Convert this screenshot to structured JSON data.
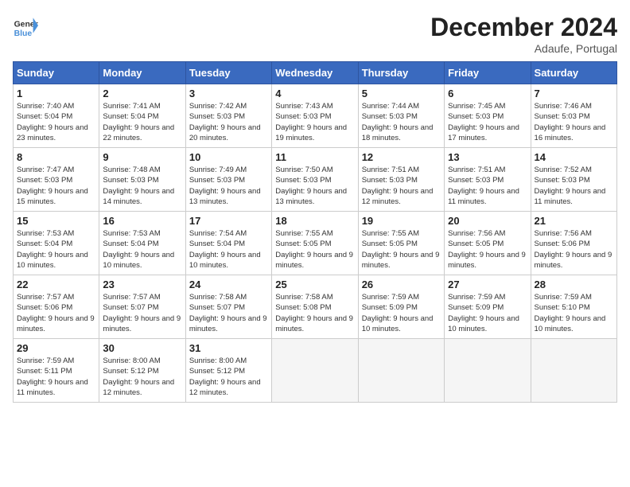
{
  "header": {
    "logo_line1": "General",
    "logo_line2": "Blue",
    "month": "December 2024",
    "location": "Adaufe, Portugal"
  },
  "weekdays": [
    "Sunday",
    "Monday",
    "Tuesday",
    "Wednesday",
    "Thursday",
    "Friday",
    "Saturday"
  ],
  "weeks": [
    [
      {
        "day": 1,
        "sunrise": "7:40 AM",
        "sunset": "5:04 PM",
        "daylight": "9 hours and 23 minutes."
      },
      {
        "day": 2,
        "sunrise": "7:41 AM",
        "sunset": "5:04 PM",
        "daylight": "9 hours and 22 minutes."
      },
      {
        "day": 3,
        "sunrise": "7:42 AM",
        "sunset": "5:03 PM",
        "daylight": "9 hours and 20 minutes."
      },
      {
        "day": 4,
        "sunrise": "7:43 AM",
        "sunset": "5:03 PM",
        "daylight": "9 hours and 19 minutes."
      },
      {
        "day": 5,
        "sunrise": "7:44 AM",
        "sunset": "5:03 PM",
        "daylight": "9 hours and 18 minutes."
      },
      {
        "day": 6,
        "sunrise": "7:45 AM",
        "sunset": "5:03 PM",
        "daylight": "9 hours and 17 minutes."
      },
      {
        "day": 7,
        "sunrise": "7:46 AM",
        "sunset": "5:03 PM",
        "daylight": "9 hours and 16 minutes."
      }
    ],
    [
      {
        "day": 8,
        "sunrise": "7:47 AM",
        "sunset": "5:03 PM",
        "daylight": "9 hours and 15 minutes."
      },
      {
        "day": 9,
        "sunrise": "7:48 AM",
        "sunset": "5:03 PM",
        "daylight": "9 hours and 14 minutes."
      },
      {
        "day": 10,
        "sunrise": "7:49 AM",
        "sunset": "5:03 PM",
        "daylight": "9 hours and 13 minutes."
      },
      {
        "day": 11,
        "sunrise": "7:50 AM",
        "sunset": "5:03 PM",
        "daylight": "9 hours and 13 minutes."
      },
      {
        "day": 12,
        "sunrise": "7:51 AM",
        "sunset": "5:03 PM",
        "daylight": "9 hours and 12 minutes."
      },
      {
        "day": 13,
        "sunrise": "7:51 AM",
        "sunset": "5:03 PM",
        "daylight": "9 hours and 11 minutes."
      },
      {
        "day": 14,
        "sunrise": "7:52 AM",
        "sunset": "5:03 PM",
        "daylight": "9 hours and 11 minutes."
      }
    ],
    [
      {
        "day": 15,
        "sunrise": "7:53 AM",
        "sunset": "5:04 PM",
        "daylight": "9 hours and 10 minutes."
      },
      {
        "day": 16,
        "sunrise": "7:53 AM",
        "sunset": "5:04 PM",
        "daylight": "9 hours and 10 minutes."
      },
      {
        "day": 17,
        "sunrise": "7:54 AM",
        "sunset": "5:04 PM",
        "daylight": "9 hours and 10 minutes."
      },
      {
        "day": 18,
        "sunrise": "7:55 AM",
        "sunset": "5:05 PM",
        "daylight": "9 hours and 9 minutes."
      },
      {
        "day": 19,
        "sunrise": "7:55 AM",
        "sunset": "5:05 PM",
        "daylight": "9 hours and 9 minutes."
      },
      {
        "day": 20,
        "sunrise": "7:56 AM",
        "sunset": "5:05 PM",
        "daylight": "9 hours and 9 minutes."
      },
      {
        "day": 21,
        "sunrise": "7:56 AM",
        "sunset": "5:06 PM",
        "daylight": "9 hours and 9 minutes."
      }
    ],
    [
      {
        "day": 22,
        "sunrise": "7:57 AM",
        "sunset": "5:06 PM",
        "daylight": "9 hours and 9 minutes."
      },
      {
        "day": 23,
        "sunrise": "7:57 AM",
        "sunset": "5:07 PM",
        "daylight": "9 hours and 9 minutes."
      },
      {
        "day": 24,
        "sunrise": "7:58 AM",
        "sunset": "5:07 PM",
        "daylight": "9 hours and 9 minutes."
      },
      {
        "day": 25,
        "sunrise": "7:58 AM",
        "sunset": "5:08 PM",
        "daylight": "9 hours and 9 minutes."
      },
      {
        "day": 26,
        "sunrise": "7:59 AM",
        "sunset": "5:09 PM",
        "daylight": "9 hours and 10 minutes."
      },
      {
        "day": 27,
        "sunrise": "7:59 AM",
        "sunset": "5:09 PM",
        "daylight": "9 hours and 10 minutes."
      },
      {
        "day": 28,
        "sunrise": "7:59 AM",
        "sunset": "5:10 PM",
        "daylight": "9 hours and 10 minutes."
      }
    ],
    [
      {
        "day": 29,
        "sunrise": "7:59 AM",
        "sunset": "5:11 PM",
        "daylight": "9 hours and 11 minutes."
      },
      {
        "day": 30,
        "sunrise": "8:00 AM",
        "sunset": "5:12 PM",
        "daylight": "9 hours and 12 minutes."
      },
      {
        "day": 31,
        "sunrise": "8:00 AM",
        "sunset": "5:12 PM",
        "daylight": "9 hours and 12 minutes."
      },
      null,
      null,
      null,
      null
    ]
  ]
}
